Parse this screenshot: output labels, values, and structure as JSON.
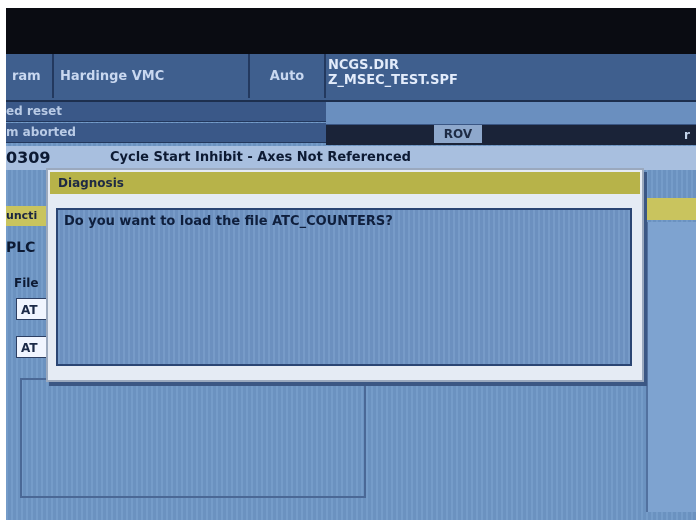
{
  "header": {
    "cell1": "ram",
    "cell2": "Hardinge VMC",
    "cell3": "Auto",
    "program_line1": "NCGS.DIR",
    "program_line2": "Z_MSEC_TEST.SPF"
  },
  "messages": {
    "line1": "ed reset",
    "line2": "m aborted"
  },
  "status_bar": {
    "rov": "ROV",
    "right_char": "r"
  },
  "alarm": {
    "number": "0309",
    "text": "Cycle Start Inhibit - Axes Not Referenced"
  },
  "left_panel": {
    "func_label": "uncti",
    "plc_label": "PLC",
    "file_label": "File",
    "field1": "AT",
    "field2": "AT"
  },
  "dialog": {
    "title": "Diagnosis",
    "message": "Do you want to load the file ATC_COUNTERS?"
  },
  "colors": {
    "screen_bg": "#6e97c6",
    "title_bar": "#b7b349",
    "header_bg": "#3f5f8e"
  }
}
